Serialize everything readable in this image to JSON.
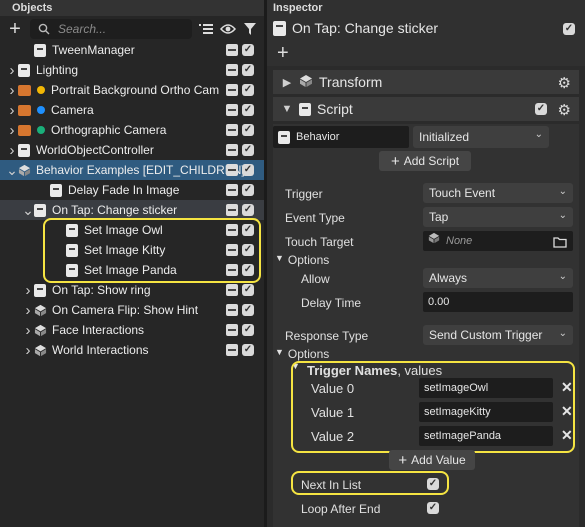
{
  "objects_panel": {
    "title": "Objects",
    "search_placeholder": "Search...",
    "tree": [
      {
        "label": "TweenManager",
        "depth": 1,
        "expander": "",
        "icon": "object"
      },
      {
        "label": "Lighting",
        "depth": 0,
        "expander": "collapsed",
        "icon": "object"
      },
      {
        "label": "Portrait Background Ortho Cam",
        "depth": 0,
        "expander": "collapsed",
        "icon": "camera",
        "dot": "#f2b705"
      },
      {
        "label": "Camera",
        "depth": 0,
        "expander": "collapsed",
        "icon": "camera",
        "dot": "#1e90ff"
      },
      {
        "label": "Orthographic Camera",
        "depth": 0,
        "expander": "collapsed",
        "icon": "camera",
        "dot": "#1aaf7a"
      },
      {
        "label": "WorldObjectController",
        "depth": 0,
        "expander": "collapsed",
        "icon": "object"
      },
      {
        "label": "Behavior Examples [EDIT_CHILDREN]",
        "depth": 0,
        "expander": "expanded",
        "icon": "group",
        "state": "selected"
      },
      {
        "label": "Delay Fade In Image",
        "depth": 2,
        "expander": "",
        "icon": "object"
      },
      {
        "label": "On Tap: Change sticker",
        "depth": 1,
        "expander": "expanded",
        "icon": "object",
        "state": "sub-selected"
      },
      {
        "label": "Set Image Owl",
        "depth": 3,
        "expander": "",
        "icon": "object"
      },
      {
        "label": "Set Image Kitty",
        "depth": 3,
        "expander": "",
        "icon": "object"
      },
      {
        "label": "Set Image Panda",
        "depth": 3,
        "expander": "",
        "icon": "object"
      },
      {
        "label": "On Tap: Show ring",
        "depth": 1,
        "expander": "collapsed",
        "icon": "object"
      },
      {
        "label": "On Camera Flip: Show Hint",
        "depth": 1,
        "expander": "collapsed",
        "icon": "group"
      },
      {
        "label": "Face Interactions",
        "depth": 1,
        "expander": "collapsed",
        "icon": "group"
      },
      {
        "label": "World Interactions",
        "depth": 1,
        "expander": "collapsed",
        "icon": "group"
      }
    ]
  },
  "inspector": {
    "title": "Inspector",
    "selected_object": "On Tap: Change sticker",
    "transform_label": "Transform",
    "script_label": "Script",
    "behavior_field": "Behavior",
    "initialized_value": "Initialized",
    "add_script_label": "Add Script",
    "rows": {
      "trigger": {
        "label": "Trigger",
        "value": "Touch Event"
      },
      "event_type": {
        "label": "Event Type",
        "value": "Tap"
      },
      "touch_target": {
        "label": "Touch Target",
        "value": "None"
      },
      "options1": "Options",
      "allow": {
        "label": "Allow",
        "value": "Always"
      },
      "delay_time": {
        "label": "Delay Time",
        "value": "0.00"
      },
      "response_type": {
        "label": "Response Type",
        "value": "Send Custom Trigger"
      },
      "options2": "Options",
      "trigger_names_bold": "Trigger Names",
      "trigger_names_rest": ", values",
      "values": [
        {
          "label": "Value 0",
          "value": "setImageOwl"
        },
        {
          "label": "Value 1",
          "value": "setImageKitty"
        },
        {
          "label": "Value 2",
          "value": "setImagePanda"
        }
      ],
      "add_value_label": "Add Value",
      "next_in_list": "Next In List",
      "loop_after_end": "Loop After End"
    }
  },
  "highlight_color": "#f5e442",
  "selection_color": "#2f5b80"
}
